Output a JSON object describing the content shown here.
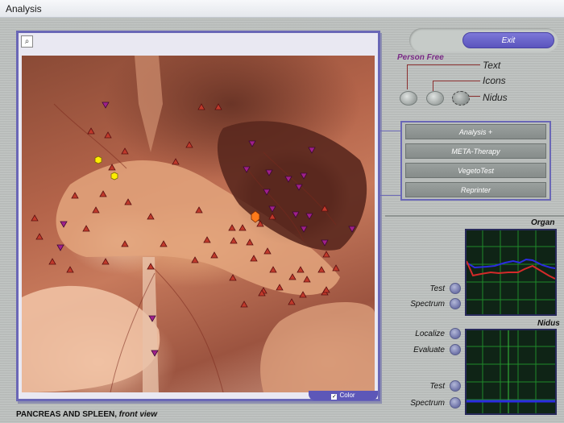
{
  "window": {
    "title": "Analysis"
  },
  "image": {
    "caption_main": "PANCREAS AND SPLEEN,",
    "caption_sub": "front view",
    "color_toggle_label": "Color",
    "color_checked": true,
    "zoom_icon": "magnifier-icon"
  },
  "header": {
    "exit_label": "Exit"
  },
  "options": {
    "group_label": "Person Free",
    "items": [
      "Text",
      "Icons",
      "Nidus"
    ],
    "selected": "Nidus"
  },
  "menu": {
    "items": [
      "Analysis +",
      "META-Therapy",
      "VegetoTest",
      "Reprinter"
    ]
  },
  "organ_panel": {
    "title": "Organ",
    "controls": [
      "Test",
      "Spectrum"
    ]
  },
  "nidus_panel": {
    "title": "Nidus",
    "controls": [
      "Localize",
      "Evaluate",
      "Test",
      "Spectrum"
    ]
  },
  "colors": {
    "accent": "#6a67b6",
    "marker_up": "#c0392b",
    "marker_down": "#a0208c",
    "marker_focus": "#ffee00",
    "graph_bg": "#0f2416",
    "trace_blue": "#2b2be0",
    "trace_red": "#d42a2a",
    "grid_green": "#1f8a2a"
  }
}
